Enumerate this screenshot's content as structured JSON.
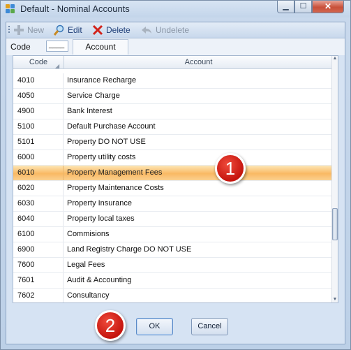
{
  "window": {
    "title": "Default - Nominal Accounts",
    "controls": {
      "minimize": "▁",
      "maximize": "☐",
      "close": "✕"
    }
  },
  "toolbar": {
    "new_label": "New",
    "edit_label": "Edit",
    "delete_label": "Delete",
    "undelete_label": "Undelete"
  },
  "filter": {
    "code_label": "Code",
    "code_value": "____",
    "account_tab": "Account"
  },
  "grid": {
    "columns": {
      "code": "Code",
      "account": "Account"
    },
    "rows": [
      {
        "code": "4010",
        "account": "Insurance Recharge"
      },
      {
        "code": "4050",
        "account": "Service Charge"
      },
      {
        "code": "4900",
        "account": "Bank Interest"
      },
      {
        "code": "5100",
        "account": "Default Purchase Account"
      },
      {
        "code": "5101",
        "account": "Property DO NOT USE"
      },
      {
        "code": "6000",
        "account": "Property utility costs"
      },
      {
        "code": "6010",
        "account": "Property Management Fees"
      },
      {
        "code": "6020",
        "account": "Property Maintenance Costs"
      },
      {
        "code": "6030",
        "account": "Property Insurance"
      },
      {
        "code": "6040",
        "account": "Property local taxes"
      },
      {
        "code": "6100",
        "account": "Commisions"
      },
      {
        "code": "6900",
        "account": "Land Registry Charge DO NOT USE"
      },
      {
        "code": "7600",
        "account": "Legal Fees"
      },
      {
        "code": "7601",
        "account": "Audit & Accounting"
      },
      {
        "code": "7602",
        "account": "Consultancy"
      }
    ],
    "selected_code": "6010"
  },
  "buttons": {
    "ok": "OK",
    "cancel": "Cancel"
  },
  "callouts": {
    "one": "1",
    "two": "2"
  },
  "colors": {
    "selection": "#f9b963",
    "callout": "#c5140d",
    "delete_icon": "#d2231b"
  }
}
